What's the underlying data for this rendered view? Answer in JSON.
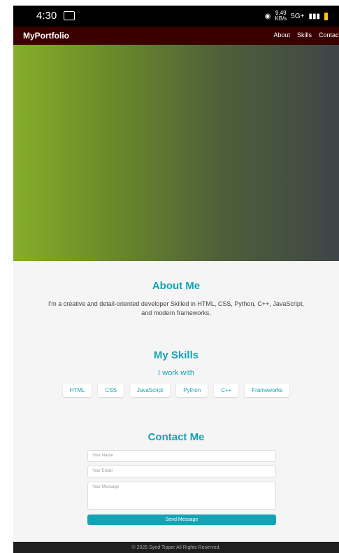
{
  "status_bar": {
    "time": "4:30",
    "speed_value": "9.49",
    "speed_unit": "KB/s",
    "network": "5G+"
  },
  "navbar": {
    "brand": "MyPortfolio",
    "links": [
      "About",
      "Skills",
      "Contact"
    ]
  },
  "about": {
    "title": "About Me",
    "text": "I'm a creative and detail-oriented developer Skilled in HTML, CSS, Python, C++, JavaScript, and modern frameworks."
  },
  "skills": {
    "title": "My Skills",
    "subtitle": "I work with",
    "items": [
      "HTML",
      "CSS",
      "JavaScript",
      "Python",
      "C++",
      "Frameworks"
    ]
  },
  "contact": {
    "title": "Contact Me",
    "name_placeholder": "Your Name",
    "email_placeholder": "Your Email",
    "message_placeholder": "Your Message",
    "send_label": "Send Message"
  },
  "footer": {
    "text": "© 2025 Syed Tipper All Rights Reserved."
  },
  "colors": {
    "accent": "#13a3b5",
    "navbar": "#3a0000",
    "footer": "#1e1e1e"
  }
}
